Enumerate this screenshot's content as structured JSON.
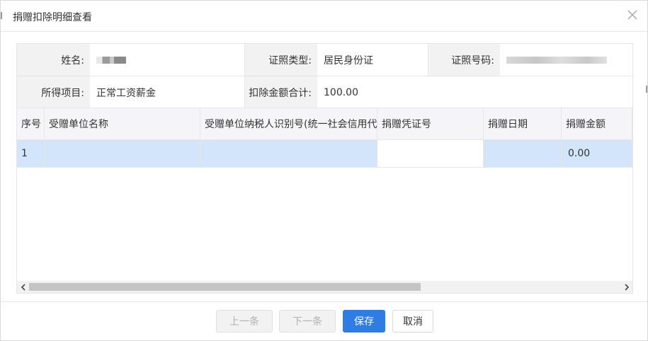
{
  "dialog": {
    "title": "捐赠扣除明细查看"
  },
  "info": {
    "name_label": "姓名:",
    "name_value": "",
    "id_type_label": "证照类型:",
    "id_type_value": "居民身份证",
    "id_number_label": "证照号码:",
    "id_number_value": "",
    "income_item_label": "所得项目:",
    "income_item_value": "正常工资薪金",
    "total_label": "扣除金额合计:",
    "total_value": "100.00"
  },
  "table": {
    "headers": [
      "序号",
      "受赠单位名称",
      "受赠单位纳税人识别号(统一社会信用代码)",
      "捐赠凭证号",
      "捐赠日期",
      "捐赠金额"
    ],
    "rows": [
      [
        "1",
        "",
        "",
        "",
        "",
        "0.00"
      ]
    ]
  },
  "footer": {
    "prev_label": "上一条",
    "next_label": "下一条",
    "save_label": "保存",
    "cancel_label": "取消"
  },
  "colors": {
    "primary": "#2e7de4",
    "selected_row": "#d3e5fb",
    "label_bg": "#f2f2f2"
  },
  "icons": {
    "close": "close-icon",
    "scroll_left": "chevron-left-icon",
    "scroll_right": "chevron-right-icon"
  }
}
